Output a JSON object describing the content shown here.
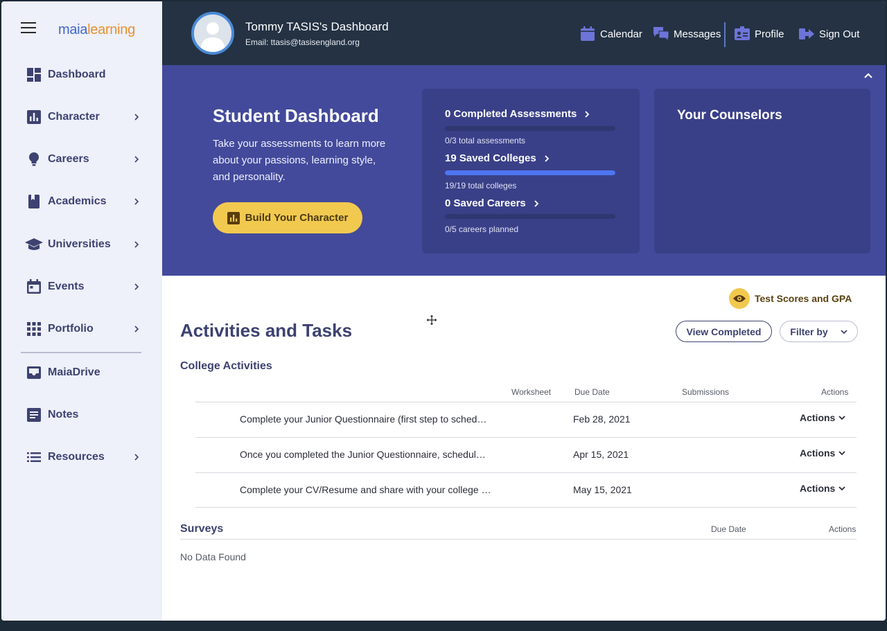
{
  "sidebar": {
    "logo": {
      "part1": "maia",
      "part2": "learning"
    },
    "items": [
      {
        "label": "Dashboard",
        "icon": "dashboard-icon",
        "chevron": false
      },
      {
        "label": "Character",
        "icon": "bar-chart-icon",
        "chevron": true
      },
      {
        "label": "Careers",
        "icon": "lightbulb-icon",
        "chevron": true
      },
      {
        "label": "Academics",
        "icon": "book-icon",
        "chevron": true
      },
      {
        "label": "Universities",
        "icon": "graduation-cap-icon",
        "chevron": true
      },
      {
        "label": "Events",
        "icon": "calendar-icon",
        "chevron": true
      },
      {
        "label": "Portfolio",
        "icon": "grid-icon",
        "chevron": true
      },
      {
        "label": "MaiaDrive",
        "icon": "inbox-icon",
        "chevron": false
      },
      {
        "label": "Notes",
        "icon": "note-icon",
        "chevron": false
      },
      {
        "label": "Resources",
        "icon": "list-icon",
        "chevron": true
      }
    ]
  },
  "header": {
    "title": "Tommy TASIS's Dashboard",
    "email": "Email: ttasis@tasisengland.org",
    "links": {
      "calendar": "Calendar",
      "messages": "Messages",
      "profile": "Profile",
      "signout": "Sign Out"
    }
  },
  "banner": {
    "title": "Student Dashboard",
    "description": "Take your assessments to learn more about your passions, learning style, and personality.",
    "build_button": "Build Your Character",
    "stats": [
      {
        "label": "0 Completed Assessments",
        "sub": "0/3 total assessments",
        "progress": 0
      },
      {
        "label": "19 Saved Colleges",
        "sub": "19/19 total colleges",
        "progress": 1
      },
      {
        "label": "0 Saved Careers",
        "sub": "0/5 careers planned",
        "progress": 0
      }
    ],
    "counselors_title": "Your Counselors"
  },
  "main": {
    "test_scores": "Test Scores and GPA",
    "title": "Activities and Tasks",
    "view_completed": "View Completed",
    "filter_by": "Filter by",
    "college_activities": {
      "title": "College Activities",
      "columns": {
        "worksheet": "Worksheet",
        "due_date": "Due Date",
        "submissions": "Submissions",
        "actions": "Actions"
      },
      "rows": [
        {
          "name": "Complete your Junior Questionnaire (first step to sched…",
          "due": "Feb 28, 2021",
          "action": "Actions"
        },
        {
          "name": "Once you completed the Junior Questionnaire, schedul…",
          "due": "Apr 15, 2021",
          "action": "Actions"
        },
        {
          "name": "Complete your CV/Resume and share with your college …",
          "due": "May 15, 2021",
          "action": "Actions"
        }
      ]
    },
    "surveys": {
      "title": "Surveys",
      "columns": {
        "due_date": "Due Date",
        "actions": "Actions"
      },
      "empty": "No Data Found"
    }
  },
  "colors": {
    "navy": "#243244",
    "banner": "#434a9b",
    "card": "#3a4088",
    "accent_yellow": "#f2c94f",
    "progress_blue": "#4d76f2",
    "text_indigo": "#3d4270"
  }
}
